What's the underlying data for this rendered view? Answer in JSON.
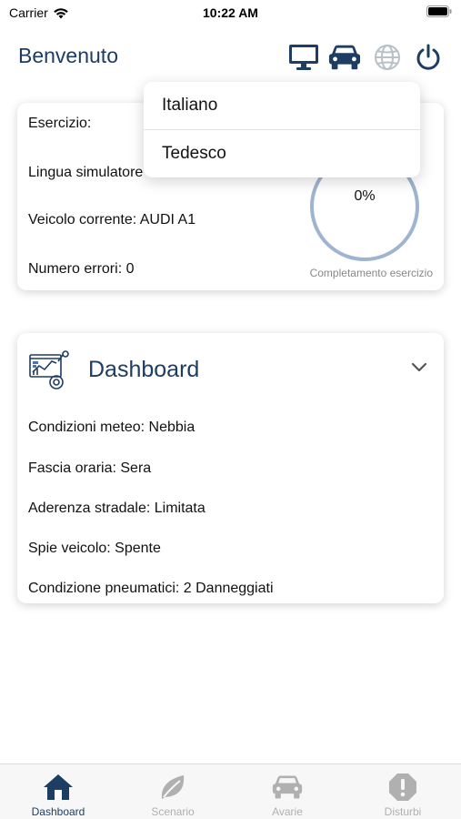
{
  "status_bar": {
    "carrier": "Carrier",
    "time": "10:22 AM"
  },
  "header": {
    "title": "Benvenuto",
    "icons": [
      "monitor-icon",
      "car-icon",
      "globe-icon",
      "power-icon"
    ]
  },
  "exercise_card": {
    "esercizio_label": "Esercizio:",
    "lingua_label": "Lingua simulatore",
    "veicolo_label": "Veicolo corrente: AUDI A1",
    "errori_label": "Numero errori: 0",
    "progress_text": "0%",
    "progress_value": 0,
    "progress_caption": "Completamento esercizio"
  },
  "language_dropdown": {
    "options": [
      "Italiano",
      "Tedesco"
    ]
  },
  "dashboard_card": {
    "title": "Dashboard",
    "rows": [
      "Condizioni meteo: Nebbia",
      "Fascia oraria: Sera",
      "Aderenza stradale: Limitata",
      "Spie veicolo: Spente",
      "Condizione pneumatici: 2 Danneggiati"
    ]
  },
  "tabbar": {
    "tabs": [
      {
        "label": "Dashboard",
        "icon": "home-icon",
        "active": true
      },
      {
        "label": "Scenario",
        "icon": "leaf-icon",
        "active": false
      },
      {
        "label": "Avarie",
        "icon": "car-icon",
        "active": false
      },
      {
        "label": "Disturbi",
        "icon": "alert-icon",
        "active": false
      }
    ]
  },
  "colors": {
    "accent": "#1e3d63",
    "inactive": "#b0b0b0",
    "progress_ring": "#9fb4d0"
  }
}
